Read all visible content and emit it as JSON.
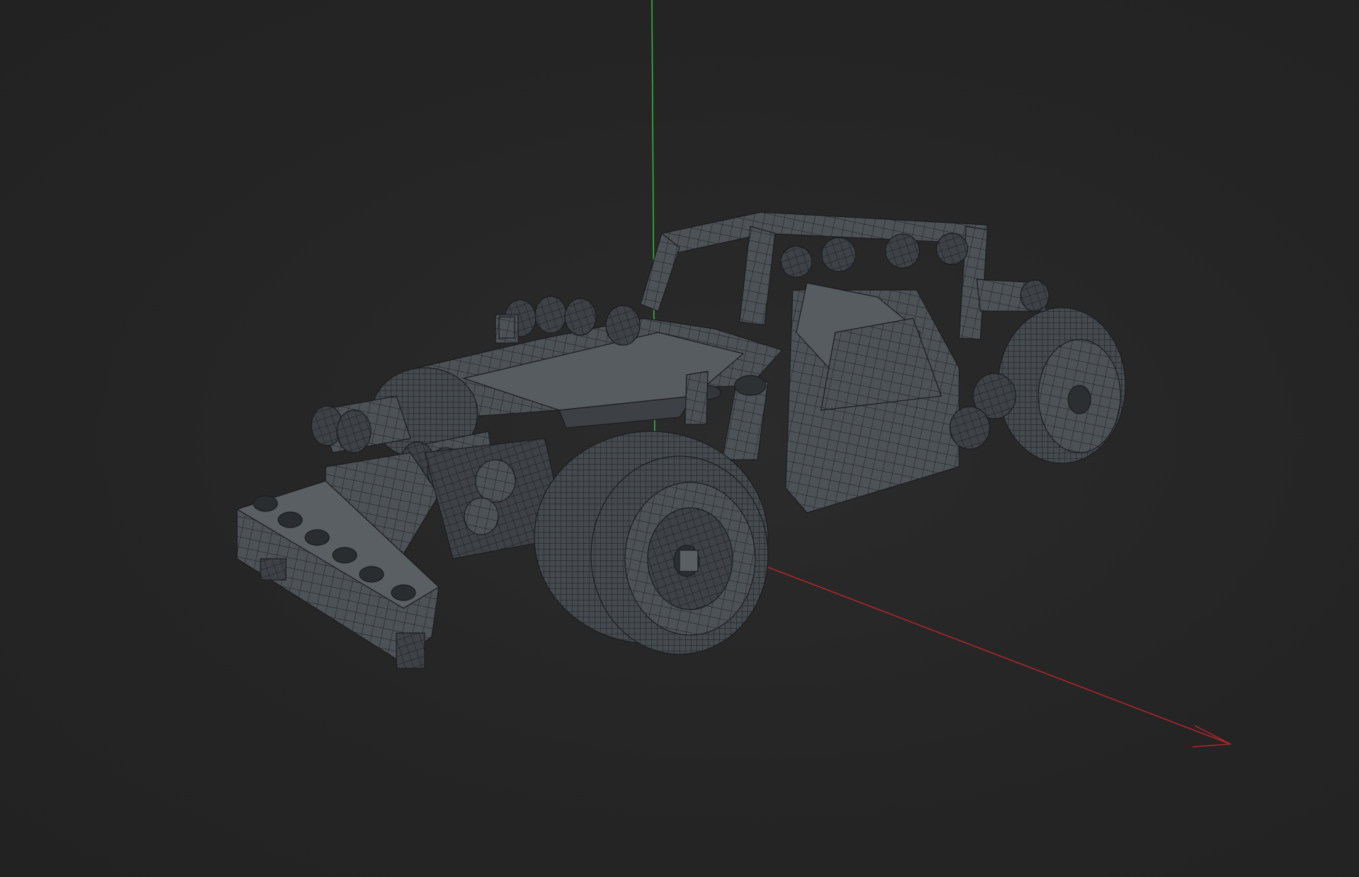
{
  "viewport": {
    "background_color": "#242424",
    "model_color": "#4d5257",
    "wire_color": "#1b1d20",
    "highlight_color": "#6a7076"
  },
  "axes": {
    "y_axis_color": "#2fbf3c",
    "x_axis_color": "#b3262a"
  },
  "model": {
    "type": "wireframe-toy-car"
  }
}
